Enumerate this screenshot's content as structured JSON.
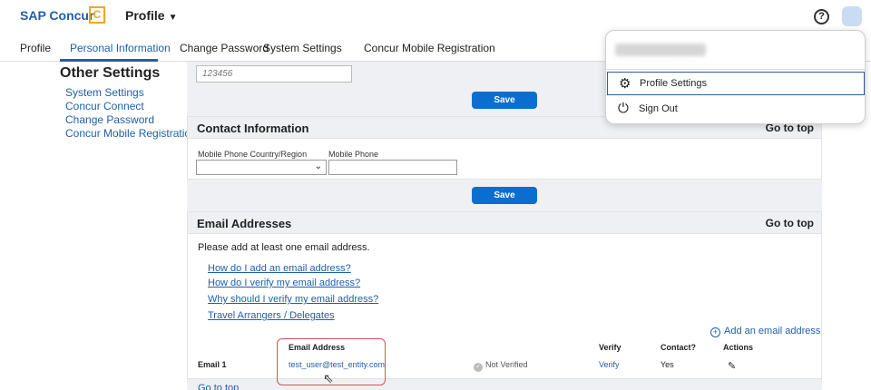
{
  "header": {
    "brand": "SAP Concur",
    "brand_mark": "C",
    "profile_menu": "Profile"
  },
  "tabs": [
    {
      "label": "Profile"
    },
    {
      "label": "Personal Information",
      "active": true
    },
    {
      "label": "Change Password"
    },
    {
      "label": "System Settings"
    },
    {
      "label": "Concur Mobile Registration"
    }
  ],
  "sidebar": {
    "title": "Other Settings",
    "links": [
      "System Settings",
      "Concur Connect",
      "Change Password",
      "Concur Mobile Registration"
    ]
  },
  "top_form": {
    "phone_placeholder": "123456",
    "save_label": "Save"
  },
  "contact": {
    "title": "Contact Information",
    "goto_top": "Go to top",
    "country_label": "Mobile Phone Country/Region",
    "phone_label": "Mobile Phone",
    "save_label": "Save"
  },
  "email": {
    "title": "Email Addresses",
    "goto_top": "Go to top",
    "intro": "Please add at least one email address.",
    "help_links": [
      "How do I add an email address?",
      "How do I verify my email address?",
      "Why should I verify my email address?",
      "Travel Arrangers / Delegates"
    ],
    "add_label": "Add an email address",
    "columns": {
      "email": "Email Address",
      "verify": "Verify",
      "contact": "Contact?",
      "actions": "Actions"
    },
    "rows": [
      {
        "label": "Email 1",
        "address": "test_user@test_entity.com",
        "status": "Not Verified",
        "verify": "Verify",
        "contact": "Yes"
      }
    ],
    "goto_top_bottom": "Go to top"
  },
  "dropdown": {
    "items": [
      {
        "label": "Profile Settings",
        "icon": "gear-icon",
        "selected": true
      },
      {
        "label": "Sign Out",
        "icon": "power-icon"
      }
    ]
  },
  "colors": {
    "accent": "#1f5fa8",
    "button": "#0a6ed1",
    "brand_orange": "#f5a623",
    "highlight": "#d9534f"
  }
}
